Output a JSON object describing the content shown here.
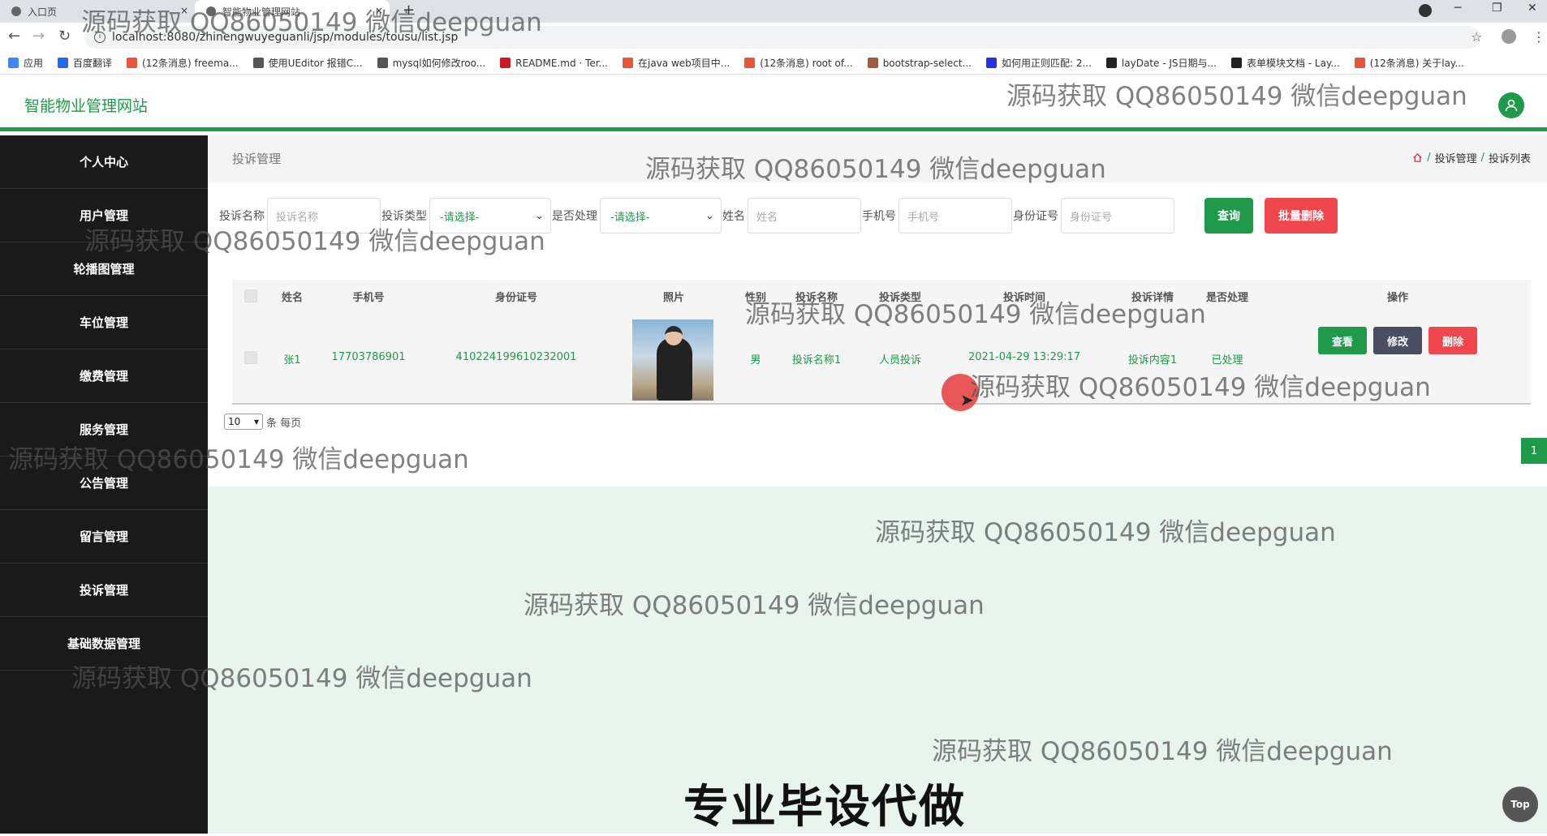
{
  "browser": {
    "tabs": [
      {
        "title": "入口页",
        "close": "×"
      },
      {
        "title": "智能物业管理网站",
        "close": "×"
      }
    ],
    "new_tab": "+",
    "url": "localhost:8080/zhinengwuyeguanli/jsp/modules/tousu/list.jsp",
    "bookmarks": [
      {
        "label": "应用",
        "color": "#4285f4"
      },
      {
        "label": "百度翻译",
        "color": "#2468f2"
      },
      {
        "label": "(12条消息) freema...",
        "color": "#e8553d"
      },
      {
        "label": "使用UEditor 报错C...",
        "color": "#555555"
      },
      {
        "label": "mysql如何修改roo...",
        "color": "#555555"
      },
      {
        "label": "README.md · Ter...",
        "color": "#c71d23"
      },
      {
        "label": "在java web项目中...",
        "color": "#e8553d"
      },
      {
        "label": "(12条消息) root of...",
        "color": "#e8553d"
      },
      {
        "label": "bootstrap-select...",
        "color": "#a05a3c"
      },
      {
        "label": "如何用正则匹配: 2...",
        "color": "#2932e1"
      },
      {
        "label": "layDate - JS日期与...",
        "color": "#222222"
      },
      {
        "label": "表单模块文档 - Lay...",
        "color": "#222222"
      },
      {
        "label": "(12条消息) 关于lay...",
        "color": "#e8553d"
      }
    ]
  },
  "header": {
    "title": "智能物业管理网站"
  },
  "sidebar": {
    "items": [
      "个人中心",
      "用户管理",
      "轮播图管理",
      "车位管理",
      "缴费管理",
      "服务管理",
      "公告管理",
      "留言管理",
      "投诉管理",
      "基础数据管理"
    ]
  },
  "breadcrumb": {
    "section": "投诉管理",
    "path": [
      "投诉管理",
      "投诉列表"
    ],
    "sep": "/"
  },
  "search": {
    "name_label": "投诉名称",
    "name_placeholder": "投诉名称",
    "type_label": "投诉类型",
    "type_value": "-请选择-",
    "handled_label": "是否处理",
    "handled_value": "-请选择-",
    "person_label": "姓名",
    "person_placeholder": "姓名",
    "phone_label": "手机号",
    "phone_placeholder": "手机号",
    "id_label": "身份证号",
    "id_placeholder": "身份证号",
    "query_button": "查询",
    "batch_delete_button": "批量删除"
  },
  "table": {
    "headers": [
      "姓名",
      "手机号",
      "身份证号",
      "照片",
      "性别",
      "投诉名称",
      "投诉类型",
      "投诉时间",
      "投诉详情",
      "是否处理",
      "操作"
    ],
    "rows": [
      {
        "name": "张1",
        "phone": "17703786901",
        "id_number": "410224199610232001",
        "gender": "男",
        "title": "投诉名称1",
        "type": "人员投诉",
        "time": "2021-04-29 13:29:17",
        "detail": "投诉内容1",
        "handled": "已处理"
      }
    ],
    "actions": {
      "view": "查看",
      "edit": "修改",
      "delete": "删除"
    }
  },
  "pager": {
    "page_size": "10",
    "per_page_text": "条 每页",
    "current_page": "1"
  },
  "top_button": "Top",
  "watermark": "源码获取 QQ86050149 微信deepguan",
  "banner": "专业毕设代做",
  "colors": {
    "primary": "#1e9a4a",
    "danger": "#f0474f",
    "secondary": "#4a4e63"
  }
}
